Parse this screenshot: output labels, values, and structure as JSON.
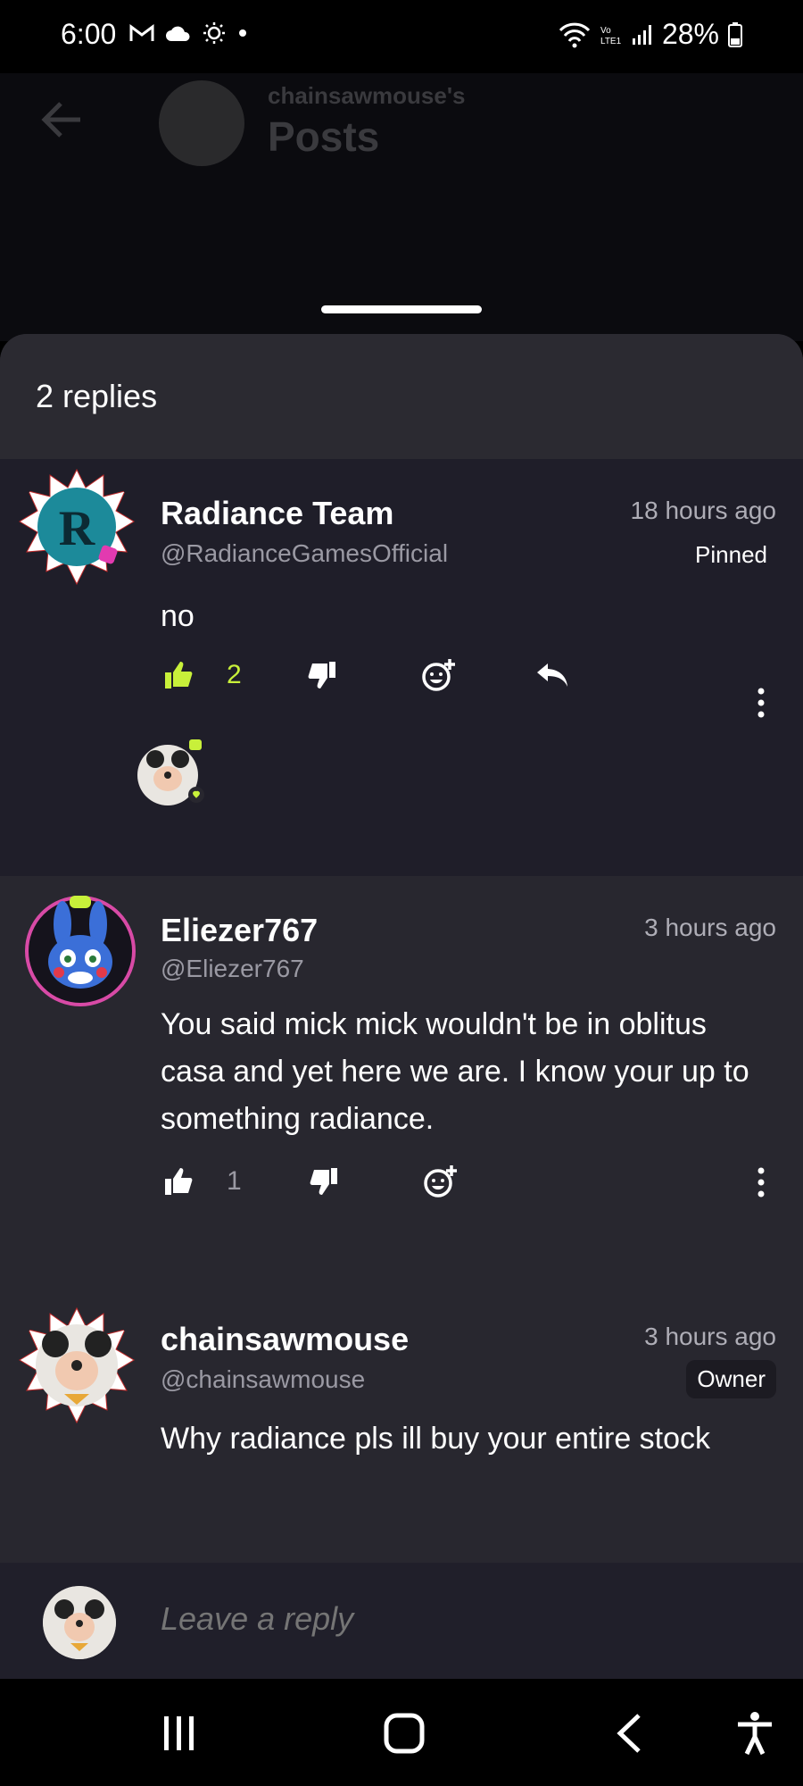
{
  "status_bar": {
    "time": "6:00",
    "battery": "28%",
    "icons": [
      "gmail-icon",
      "cloud-icon",
      "brightness-icon",
      "dot-icon",
      "wifi-icon",
      "lte-icon",
      "signal-icon",
      "battery-icon"
    ]
  },
  "background_header": {
    "subtitle": "chainsawmouse's",
    "title": "Posts"
  },
  "sheet": {
    "replies_label": "2 replies"
  },
  "comments": [
    {
      "name": "Radiance Team",
      "handle": "@RadianceGamesOfficial",
      "time": "18 hours ago",
      "tag": "Pinned",
      "text": "no",
      "likes": "2",
      "liked": true
    },
    {
      "name": "Eliezer767",
      "handle": "@Eliezer767",
      "time": "3 hours ago",
      "text": "You said mick mick wouldn't be in oblitus casa and yet here we are. I know your up to something radiance.",
      "likes": "1",
      "liked": false
    },
    {
      "name": "chainsawmouse",
      "handle": "@chainsawmouse",
      "time": "3 hours ago",
      "tag": "Owner",
      "text": "Why radiance pls ill buy your entire stock"
    }
  ],
  "reply_bar": {
    "placeholder": "Leave a reply"
  },
  "colors": {
    "accent": "#c8f03a",
    "sheet_bg": "#28272f",
    "pinned_bg": "#1f1e29"
  }
}
